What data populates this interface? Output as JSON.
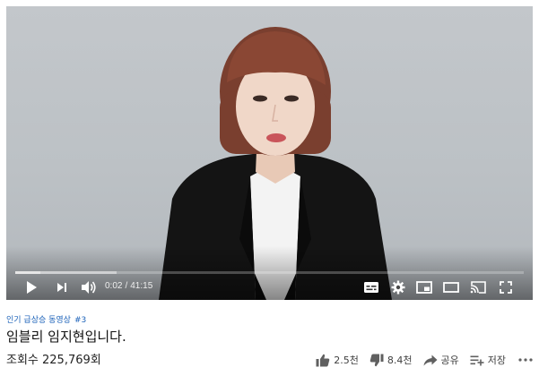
{
  "player": {
    "time_current": "0:02",
    "time_separator": "/",
    "time_total": "41:15",
    "progress_played": 0.05,
    "progress_loaded": 0.2
  },
  "video": {
    "hashtags": [
      "인기 급상승 동영상",
      "#3"
    ],
    "title": "임블리 임지현입니다.",
    "views": "조회수 225,769회"
  },
  "actions": {
    "like_count": "2.5천",
    "dislike_count": "8.4천",
    "share_label": "공유",
    "save_label": "저장"
  },
  "icons": {
    "play": "play-icon",
    "next": "next-icon",
    "volume": "volume-icon",
    "subtitles": "subtitles-icon",
    "settings": "gear-icon",
    "miniplayer": "miniplayer-icon",
    "theater": "theater-icon",
    "cast": "cast-icon",
    "fullscreen": "fullscreen-icon",
    "like": "thumbs-up-icon",
    "dislike": "thumbs-down-icon",
    "share": "share-icon",
    "save": "playlist-add-icon",
    "more": "more-horizontal-icon"
  },
  "colors": {
    "link_blue": "#1c62b9",
    "backdrop": "#bcc1c5"
  }
}
